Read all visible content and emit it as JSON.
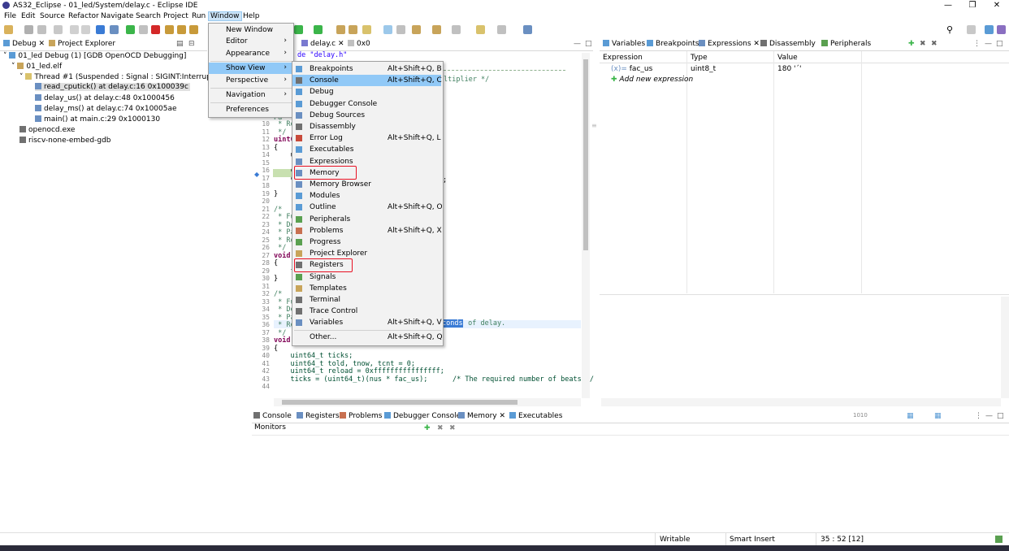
{
  "window": {
    "title": "AS32_Eclipse - 01_led/System/delay.c - Eclipse IDE"
  },
  "menubar": [
    "File",
    "Edit",
    "Source",
    "Refactor",
    "Navigate",
    "Search",
    "Project",
    "Run",
    "Window",
    "Help"
  ],
  "debug_view": {
    "tabs": [
      "Debug",
      "Project Explorer"
    ],
    "tree": [
      "01_led Debug (1) [GDB OpenOCD Debugging]",
      "01_led.elf",
      "Thread #1 (Suspended : Signal : SIGINT:Interrupt)",
      "read_cputick() at delay.c:16 0x100039c",
      "delay_us() at delay.c:48 0x1000456",
      "delay_ms() at delay.c:74 0x10005ae",
      "main() at main.c:29 0x1000130",
      "openocd.exe",
      "riscv-none-embed-gdb"
    ]
  },
  "editor": {
    "tabs": [
      "delay.c",
      "0x0"
    ],
    "top_fragment_1": "de \"delay.h\"",
    "top_fragment_2": "ltiplier */",
    "lines": [
      {
        "n": "10",
        "t": " * Re"
      },
      {
        "n": "11",
        "t": " */"
      },
      {
        "n": "12",
        "t": "uint6"
      },
      {
        "n": "13",
        "t": "{"
      },
      {
        "n": "14",
        "t": "    u"
      },
      {
        "n": "15",
        "t": ""
      },
      {
        "n": "16",
        "t": "    c"
      },
      {
        "n": "17",
        "t": "    c"
      },
      {
        "n": "18",
        "t": "    r"
      },
      {
        "n": "19",
        "t": "}"
      },
      {
        "n": "20",
        "t": ""
      },
      {
        "n": "21",
        "t": "/*"
      },
      {
        "n": "22",
        "t": " * Fu"
      },
      {
        "n": "23",
        "t": " * De"
      },
      {
        "n": "24",
        "t": " * Pa"
      },
      {
        "n": "25",
        "t": " * Re"
      },
      {
        "n": "26",
        "t": " */"
      },
      {
        "n": "27",
        "t": "void"
      },
      {
        "n": "28",
        "t": "{"
      },
      {
        "n": "29",
        "t": "    f"
      },
      {
        "n": "30",
        "t": "}"
      },
      {
        "n": "31",
        "t": ""
      },
      {
        "n": "32",
        "t": "/*"
      },
      {
        "n": "33",
        "t": " * Fu"
      },
      {
        "n": "34",
        "t": " * De"
      },
      {
        "n": "35",
        "t": " * Pa"
      },
      {
        "n": "36",
        "t": " * Re"
      },
      {
        "n": "37",
        "t": " */"
      },
      {
        "n": "38",
        "t": "void delay_us(uint32_t nus)"
      },
      {
        "n": "39",
        "t": "{"
      },
      {
        "n": "40",
        "t": "    uint64_t ticks;"
      },
      {
        "n": "41",
        "t": "    uint64_t told, tnow, tcnt = 0;"
      },
      {
        "n": "42",
        "t": "    uint64_t reload = 0xffffffffffffffff;"
      },
      {
        "n": "43",
        "t": "    ticks = (uint64_t)(nus * fac_us);      /* The required number of beats */"
      },
      {
        "n": "44",
        "t": ""
      }
    ],
    "line9_fragment": "Pa",
    "line17_tail": ";",
    "line35_sel": "conds",
    "line35_tail": " of delay."
  },
  "window_menu": {
    "items": [
      "New Window",
      "Editor",
      "Appearance",
      "Show View",
      "Perspective",
      "Navigation",
      "Preferences"
    ]
  },
  "show_view_menu": {
    "items": [
      {
        "label": "Breakpoints",
        "sc": "Alt+Shift+Q, B",
        "icon": "breakpoints-icon"
      },
      {
        "label": "Console",
        "sc": "Alt+Shift+Q, C",
        "icon": "console-icon"
      },
      {
        "label": "Debug",
        "sc": "",
        "icon": "debug-icon"
      },
      {
        "label": "Debugger Console",
        "sc": "",
        "icon": "debugger-console-icon"
      },
      {
        "label": "Debug Sources",
        "sc": "",
        "icon": "debug-sources-icon"
      },
      {
        "label": "Disassembly",
        "sc": "",
        "icon": "disassembly-icon"
      },
      {
        "label": "Error Log",
        "sc": "Alt+Shift+Q, L",
        "icon": "error-log-icon"
      },
      {
        "label": "Executables",
        "sc": "",
        "icon": "executables-icon"
      },
      {
        "label": "Expressions",
        "sc": "",
        "icon": "expressions-icon"
      },
      {
        "label": "Memory",
        "sc": "",
        "icon": "memory-icon"
      },
      {
        "label": "Memory Browser",
        "sc": "",
        "icon": "memory-browser-icon"
      },
      {
        "label": "Modules",
        "sc": "",
        "icon": "modules-icon"
      },
      {
        "label": "Outline",
        "sc": "Alt+Shift+Q, O",
        "icon": "outline-icon"
      },
      {
        "label": "Peripherals",
        "sc": "",
        "icon": "peripherals-icon"
      },
      {
        "label": "Problems",
        "sc": "Alt+Shift+Q, X",
        "icon": "problems-icon"
      },
      {
        "label": "Progress",
        "sc": "",
        "icon": "progress-icon"
      },
      {
        "label": "Project Explorer",
        "sc": "",
        "icon": "project-explorer-icon"
      },
      {
        "label": "Registers",
        "sc": "",
        "icon": "registers-icon"
      },
      {
        "label": "Signals",
        "sc": "",
        "icon": "signals-icon"
      },
      {
        "label": "Templates",
        "sc": "",
        "icon": "templates-icon"
      },
      {
        "label": "Terminal",
        "sc": "",
        "icon": "terminal-icon"
      },
      {
        "label": "Trace Control",
        "sc": "",
        "icon": "trace-control-icon"
      },
      {
        "label": "Variables",
        "sc": "Alt+Shift+Q, V",
        "icon": "variables-icon"
      },
      {
        "label": "Other...",
        "sc": "Alt+Shift+Q, Q",
        "icon": ""
      }
    ]
  },
  "right_panel": {
    "tabs": [
      "Variables",
      "Breakpoints",
      "Expressions",
      "Disassembly",
      "Peripherals"
    ],
    "columns": [
      "Expression",
      "Type",
      "Value"
    ],
    "row": {
      "expr": "fac_us",
      "type": "uint8_t",
      "value": "180 '´'"
    },
    "add_label": "Add new expression"
  },
  "bottom_panel": {
    "tabs": [
      "Console",
      "Registers",
      "Problems",
      "Debugger Console",
      "Memory",
      "Executables"
    ],
    "monitors_label": "Monitors"
  },
  "statusbar": {
    "writable": "Writable",
    "insert": "Smart Insert",
    "position": "35 : 52 [12]"
  },
  "colors": {
    "accent": "#91c9f7",
    "highlight_box": "#e81123",
    "selection": "#cce4f7"
  }
}
